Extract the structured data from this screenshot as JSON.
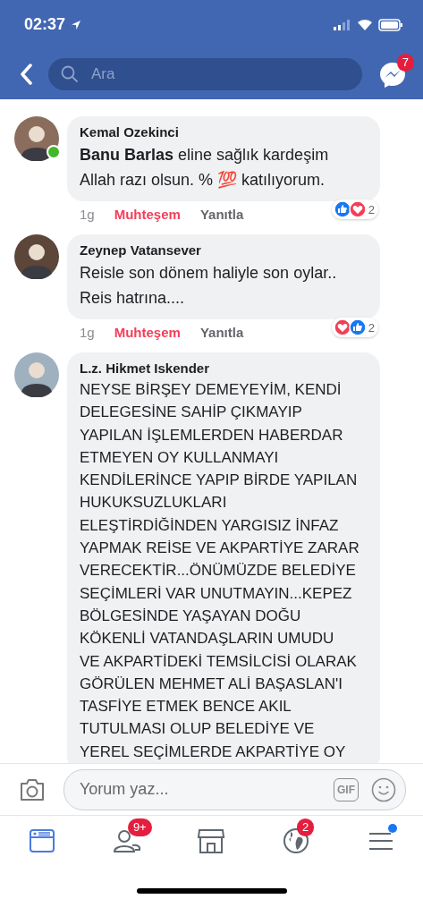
{
  "status_bar": {
    "time": "02:37"
  },
  "nav": {
    "search": {
      "placeholder": "Ara"
    },
    "messenger_badge": "7"
  },
  "comments": [
    {
      "author": "Kemal Ozekinci",
      "online": true,
      "text": "**Banu Barlas** eline sağlık kardeşim",
      "lines": [
        "Allah razı olsun. % 💯 katılıyorum."
      ],
      "caps": false,
      "time": "1g",
      "reaction_label": "Muhteşem",
      "reacted": true,
      "reply": "Yanıtla",
      "reactions": [
        {
          "kind": "like"
        },
        {
          "kind": "love"
        }
      ],
      "reaction_count": "2"
    },
    {
      "author": "Zeynep Vatansever",
      "online": false,
      "text": "Reisle son dönem haliyle son oylar..",
      "lines": [
        "Reis hatrına...."
      ],
      "caps": false,
      "time": "1g",
      "reaction_label": "Muhteşem",
      "reacted": true,
      "reply": "Yanıtla",
      "reactions": [
        {
          "kind": "love"
        },
        {
          "kind": "like"
        }
      ],
      "reaction_count": "2"
    },
    {
      "author": "L.z. Hikmet Iskender",
      "online": false,
      "caps": true,
      "text": "NEYSE BİRŞEY DEMEYEYİM, KENDİ",
      "lines": [
        "DELEGESİNE SAHİP ÇIKMAYIP",
        "YAPILAN İŞLEMLERDEN HABERDAR",
        "ETMEYEN OY KULLANMAYI",
        "KENDİLERİNCE YAPIP BİRDE YAPILAN",
        "HUKUKSUZLUKLARI",
        "ELEŞTİRDİĞİNDEN YARGISIZ İNFAZ",
        "YAPMAK REİSE VE AKPARTİYE ZARAR",
        "VERECEKTİR...ÖNÜMÜZDE BELEDİYE",
        "SEÇİMLERİ VAR UNUTMAYIN...KEPEZ",
        "BÖLGESİNDE YAŞAYAN DOĞU",
        "KÖKENLİ VATANDAŞLARIN UMUDU",
        "VE AKPARTİDEKİ TEMSİLCİSİ OLARAK",
        "GÖRÜLEN MEHMET ALİ BAŞASLAN'I",
        "TASFİYE ETMEK BENCE AKIL",
        "TUTULMASI OLUP BELEDİYE VE",
        "YEREL SEÇİMLERDE AKPARTİYE OY"
      ]
    }
  ],
  "composer": {
    "placeholder": "Yorum yaz...",
    "gif": "GIF"
  },
  "tabs": [
    {
      "kind": "feed",
      "selected": true
    },
    {
      "kind": "friends",
      "selected": false,
      "badge": "9+"
    },
    {
      "kind": "market",
      "selected": false
    },
    {
      "kind": "globe",
      "selected": false,
      "badge": "2"
    },
    {
      "kind": "menu",
      "selected": false,
      "dot": true
    }
  ]
}
